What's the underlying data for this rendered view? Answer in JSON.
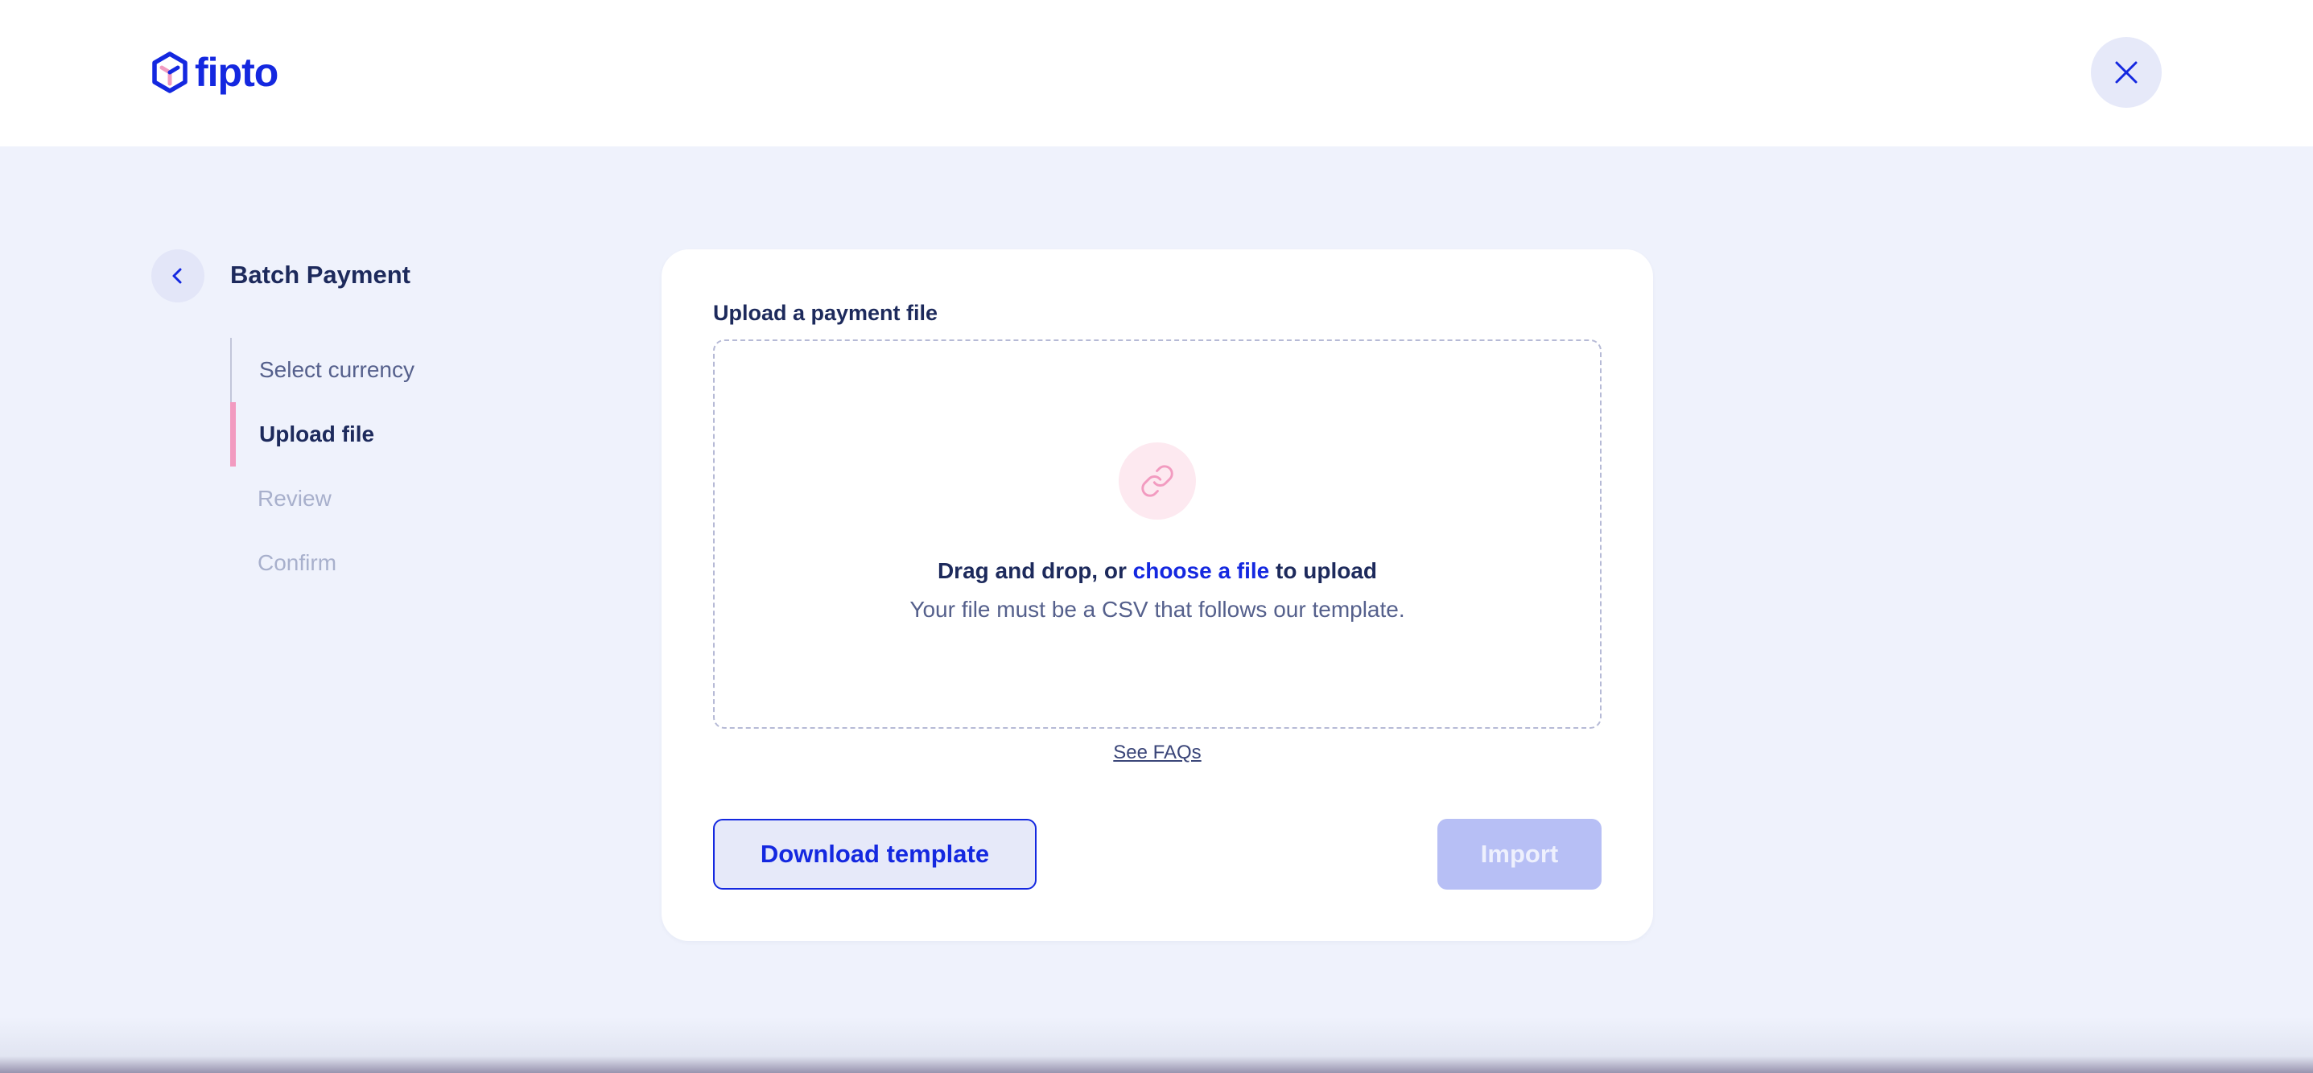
{
  "header": {
    "logo_text": "fipto",
    "close_icon": "close-icon"
  },
  "sidebar": {
    "back_icon": "chevron-left-icon",
    "title": "Batch Payment",
    "steps": [
      {
        "label": "Select currency",
        "state": "done"
      },
      {
        "label": "Upload file",
        "state": "active"
      },
      {
        "label": "Review",
        "state": "pending"
      },
      {
        "label": "Confirm",
        "state": "pending"
      }
    ]
  },
  "upload": {
    "label": "Upload a payment file",
    "icon": "link-icon",
    "drop_prefix": "Drag and drop, or ",
    "drop_link": "choose a file",
    "drop_suffix": " to upload",
    "drop_hint": "Your file must be a CSV that follows our template.",
    "faq_link": "See FAQs"
  },
  "actions": {
    "download_label": "Download template",
    "import_label": "Import"
  },
  "colors": {
    "brand": "#1428e0",
    "accent_pink": "#f29bc0",
    "background": "#eff2fc",
    "text_dark": "#1d2a5c"
  }
}
